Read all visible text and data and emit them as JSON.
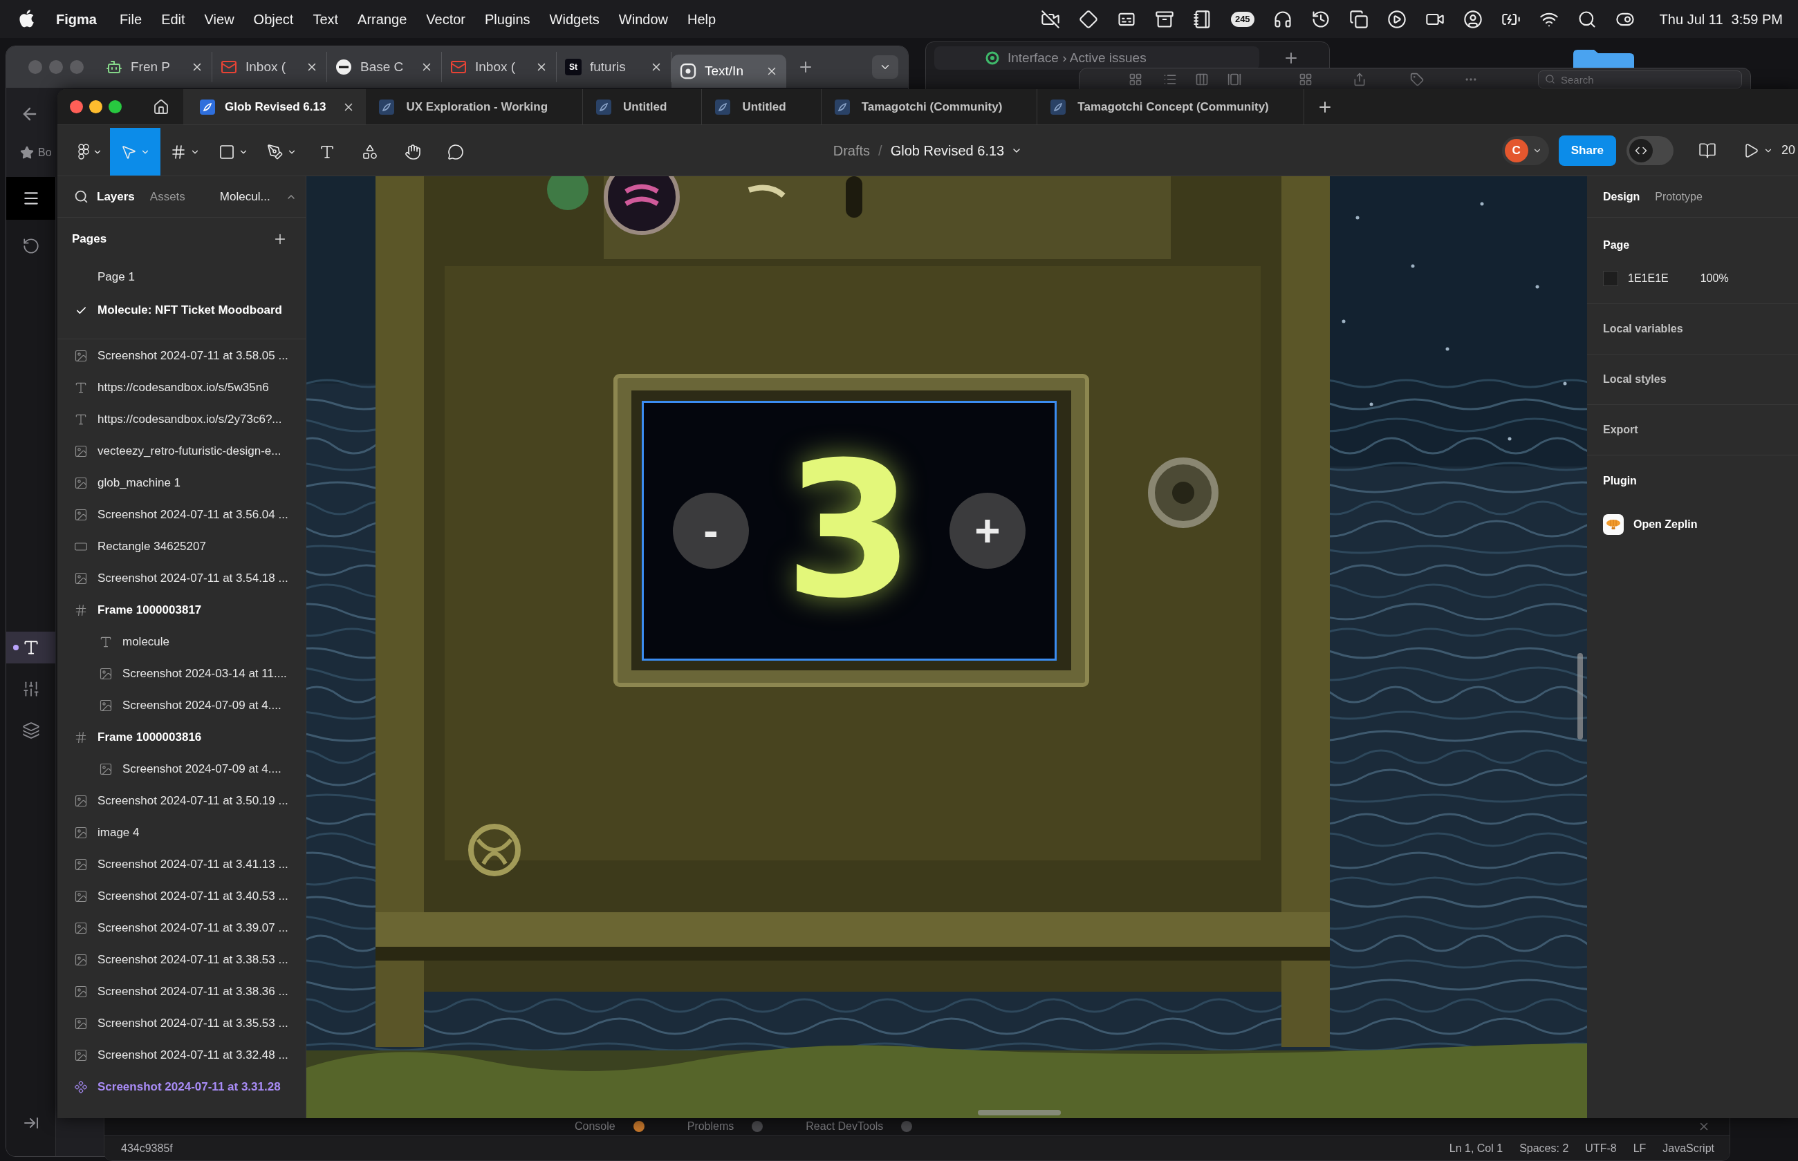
{
  "menu_bar": {
    "app": "Figma",
    "menus": [
      "File",
      "Edit",
      "View",
      "Object",
      "Text",
      "Arrange",
      "Vector",
      "Plugins",
      "Widgets",
      "Window",
      "Help"
    ],
    "notification_count": "245",
    "date": "Thu Jul 11",
    "time": "3:59 PM"
  },
  "desktop_windows": {
    "issues_tab": "Interface › Active issues",
    "search_placeholder": "Search"
  },
  "browser": {
    "tabs": [
      {
        "label": "Fren P",
        "selected": false
      },
      {
        "label": "Inbox (",
        "selected": false
      },
      {
        "label": "Base C",
        "selected": false
      },
      {
        "label": "Inbox (",
        "selected": false
      },
      {
        "label": "futuris",
        "favicon_text": "St",
        "selected": false
      },
      {
        "label": "Text/In",
        "selected": true
      }
    ],
    "bookmark_label": "Bo",
    "rail": [
      {
        "selected": false
      },
      {
        "selected": true
      },
      {
        "selected": false
      },
      {
        "selected": false
      }
    ]
  },
  "figma": {
    "file_tabs": [
      {
        "label": "Glob Revised 6.13",
        "selected": true
      },
      {
        "label": "UX Exploration - Working",
        "selected": false
      },
      {
        "label": "Untitled",
        "selected": false
      },
      {
        "label": "Untitled",
        "selected": false
      },
      {
        "label": "Tamagotchi (Community)",
        "selected": false
      },
      {
        "label": "Tamagotchi Concept (Community)",
        "selected": false
      }
    ],
    "tools": [
      {
        "selected": false,
        "dropdown": true
      },
      {
        "selected": true,
        "dropdown": true
      },
      {
        "selected": false,
        "dropdown": true
      },
      {
        "selected": false,
        "dropdown": true
      },
      {
        "selected": false,
        "dropdown": true
      },
      {
        "selected": false,
        "dropdown": false
      },
      {
        "selected": false,
        "dropdown": false
      },
      {
        "selected": false,
        "dropdown": false
      },
      {
        "selected": false,
        "dropdown": false
      }
    ],
    "breadcrumb": {
      "folder": "Drafts",
      "separator": "/",
      "file": "Glob Revised 6.13"
    },
    "avatar": "C",
    "share": "Share",
    "dev_mode": {
      "on": false
    },
    "zoom": "20"
  },
  "left_panel": {
    "tabs": [
      {
        "label": "Layers",
        "selected": true
      },
      {
        "label": "Assets",
        "selected": false
      }
    ],
    "page_menu": "Molecul...",
    "pages_title": "Pages",
    "pages": [
      {
        "name": "Page 1",
        "selected": false
      },
      {
        "name": "Molecule: NFT Ticket Moodboard",
        "selected": true
      }
    ],
    "layers": [
      {
        "kind": "image",
        "name": "Screenshot 2024-07-11 at 3.58.05 ..."
      },
      {
        "kind": "text",
        "name": "https://codesandbox.io/s/5w35n6"
      },
      {
        "kind": "text",
        "name": "https://codesandbox.io/s/2y73c6?..."
      },
      {
        "kind": "image",
        "name": "vecteezy_retro-futuristic-design-e..."
      },
      {
        "kind": "image",
        "name": "glob_machine 1"
      },
      {
        "kind": "image",
        "name": "Screenshot 2024-07-11 at 3.56.04 ..."
      },
      {
        "kind": "rectangle",
        "name": "Rectangle 34625207"
      },
      {
        "kind": "image",
        "name": "Screenshot 2024-07-11 at 3.54.18 ..."
      },
      {
        "kind": "frame",
        "name": "Frame 1000003817",
        "children": [
          {
            "kind": "text",
            "name": "molecule"
          },
          {
            "kind": "image",
            "name": "Screenshot 2024-03-14 at 11...."
          },
          {
            "kind": "image",
            "name": "Screenshot 2024-07-09 at 4...."
          }
        ]
      },
      {
        "kind": "frame",
        "name": "Frame 1000003816",
        "children": [
          {
            "kind": "image",
            "name": "Screenshot 2024-07-09 at 4...."
          }
        ]
      },
      {
        "kind": "image",
        "name": "Screenshot 2024-07-11 at 3.50.19 ..."
      },
      {
        "kind": "image",
        "name": "image 4"
      },
      {
        "kind": "image",
        "name": "Screenshot 2024-07-11 at 3.41.13 ..."
      },
      {
        "kind": "image",
        "name": "Screenshot 2024-07-11 at 3.40.53 ..."
      },
      {
        "kind": "image",
        "name": "Screenshot 2024-07-11 at 3.39.07 ..."
      },
      {
        "kind": "image",
        "name": "Screenshot 2024-07-11 at 3.38.53 ..."
      },
      {
        "kind": "image",
        "name": "Screenshot 2024-07-11 at 3.38.36 ..."
      },
      {
        "kind": "image",
        "name": "Screenshot 2024-07-11 at 3.35.53 ..."
      },
      {
        "kind": "image",
        "name": "Screenshot 2024-07-11 at 3.32.48 ..."
      },
      {
        "kind": "component",
        "name": "Screenshot 2024-07-11 at 3.31.28"
      }
    ]
  },
  "canvas": {
    "screen": {
      "selected": true,
      "minus": "-",
      "value": "3",
      "plus": "+"
    }
  },
  "right_panel": {
    "tabs": [
      {
        "label": "Design",
        "selected": true
      },
      {
        "label": "Prototype",
        "selected": false
      }
    ],
    "page": {
      "title": "Page",
      "color": "1E1E1E",
      "opacity": "100%"
    },
    "sections": [
      "Local variables",
      "Local styles",
      "Export"
    ],
    "plugin": {
      "title": "Plugin",
      "items": [
        "Open Zeplin"
      ]
    }
  },
  "code_editor": {
    "panel_tabs": [
      {
        "label": "Console",
        "color": "#c7782c"
      },
      {
        "label": "Problems",
        "color": "#4a4a4e"
      },
      {
        "label": "React DevTools",
        "color": "#4a4a4e"
      }
    ],
    "commit": "434c9385f",
    "status_items": [
      "Ln 1, Col 1",
      "Spaces: 2",
      "UTF-8",
      "LF",
      "JavaScript"
    ]
  }
}
